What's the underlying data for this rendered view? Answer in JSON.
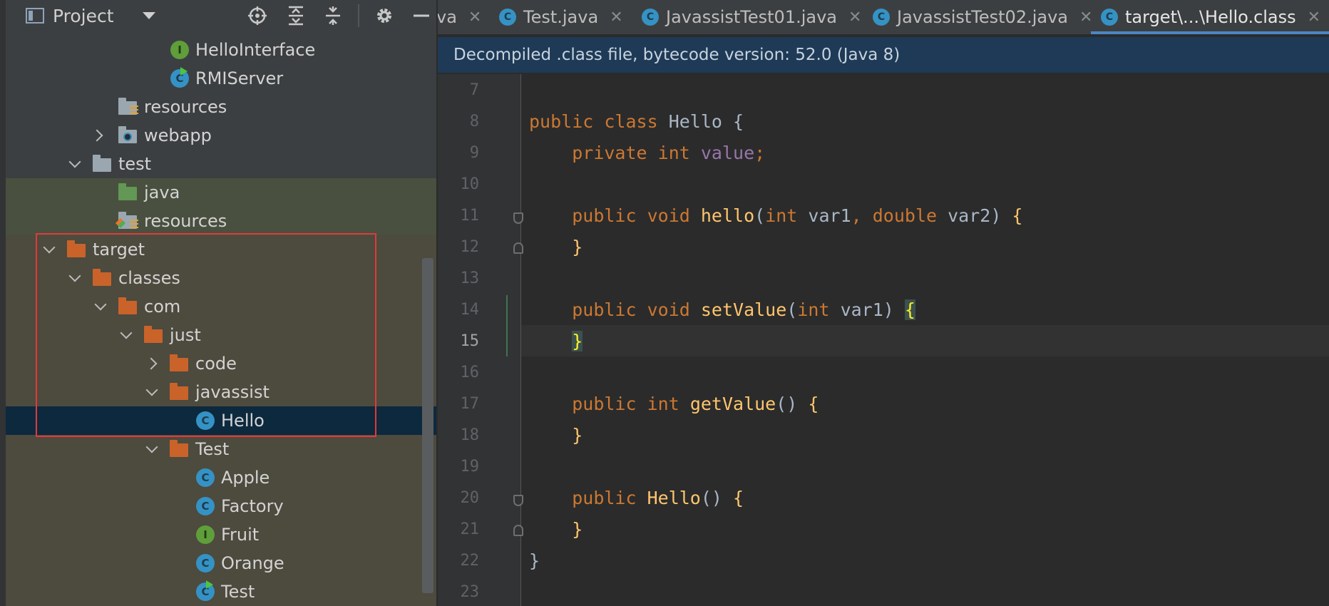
{
  "sidebar": {
    "title": "Project",
    "toolbar_icons": [
      "locate-icon",
      "expand-all-icon",
      "collapse-all-icon",
      "gear-icon",
      "minimize-icon"
    ],
    "tree": [
      {
        "label": "HelloInterface",
        "kind": "interface",
        "expanded": null
      },
      {
        "label": "RMIServer",
        "kind": "class-runnable",
        "expanded": null
      },
      {
        "label": "resources",
        "kind": "resources-folder",
        "expanded": null
      },
      {
        "label": "webapp",
        "kind": "web-folder",
        "expanded": false
      },
      {
        "label": "test",
        "kind": "folder-gray",
        "expanded": true
      },
      {
        "label": "java",
        "kind": "folder-green",
        "expanded": null
      },
      {
        "label": "resources",
        "kind": "test-resources-folder",
        "expanded": null
      },
      {
        "label": "target",
        "kind": "folder-orange",
        "expanded": true
      },
      {
        "label": "classes",
        "kind": "folder-orange",
        "expanded": true
      },
      {
        "label": "com",
        "kind": "folder-orange",
        "expanded": true
      },
      {
        "label": "just",
        "kind": "folder-orange",
        "expanded": true
      },
      {
        "label": "code",
        "kind": "folder-orange",
        "expanded": false
      },
      {
        "label": "javassist",
        "kind": "folder-orange",
        "expanded": true
      },
      {
        "label": "Hello",
        "kind": "class",
        "expanded": null,
        "selected": true
      },
      {
        "label": "Test",
        "kind": "folder-orange",
        "expanded": true
      },
      {
        "label": "Apple",
        "kind": "class",
        "expanded": null
      },
      {
        "label": "Factory",
        "kind": "class",
        "expanded": null
      },
      {
        "label": "Fruit",
        "kind": "interface",
        "expanded": null
      },
      {
        "label": "Orange",
        "kind": "class",
        "expanded": null
      },
      {
        "label": "Test",
        "kind": "class-runnable",
        "expanded": null
      }
    ]
  },
  "tabs": [
    {
      "label": "va",
      "icon": null,
      "active": false
    },
    {
      "label": "Test.java",
      "icon": "class-runnable",
      "active": false
    },
    {
      "label": "JavassistTest01.java",
      "icon": "class-runnable",
      "active": false
    },
    {
      "label": "JavassistTest02.java",
      "icon": "class-runnable",
      "active": false
    },
    {
      "label": "target\\...\\Hello.class",
      "icon": "class",
      "active": true
    }
  ],
  "banner": {
    "text": "Decompiled .class file, bytecode version: 52.0 (Java 8)"
  },
  "editor": {
    "current_line": 15,
    "lines": [
      {
        "n": "7",
        "text": ""
      },
      {
        "n": "8",
        "text": "public class Hello {"
      },
      {
        "n": "9",
        "text": "    private int value;"
      },
      {
        "n": "10",
        "text": ""
      },
      {
        "n": "11",
        "text": "    public void hello(int var1, double var2) {"
      },
      {
        "n": "12",
        "text": "    }"
      },
      {
        "n": "13",
        "text": ""
      },
      {
        "n": "14",
        "text": "    public void setValue(int var1) {"
      },
      {
        "n": "15",
        "text": "    }"
      },
      {
        "n": "16",
        "text": ""
      },
      {
        "n": "17",
        "text": "    public int getValue() {"
      },
      {
        "n": "18",
        "text": "    }"
      },
      {
        "n": "19",
        "text": ""
      },
      {
        "n": "20",
        "text": "    public Hello() {"
      },
      {
        "n": "21",
        "text": "    }"
      },
      {
        "n": "22",
        "text": "}"
      },
      {
        "n": "23",
        "text": ""
      }
    ]
  },
  "colors": {
    "keyword": "#cc7832",
    "method": "#ffc66d",
    "field": "#9876aa",
    "text": "#a9b7c6",
    "highlight_box": "#e03a3a",
    "selection": "#0d293e"
  }
}
